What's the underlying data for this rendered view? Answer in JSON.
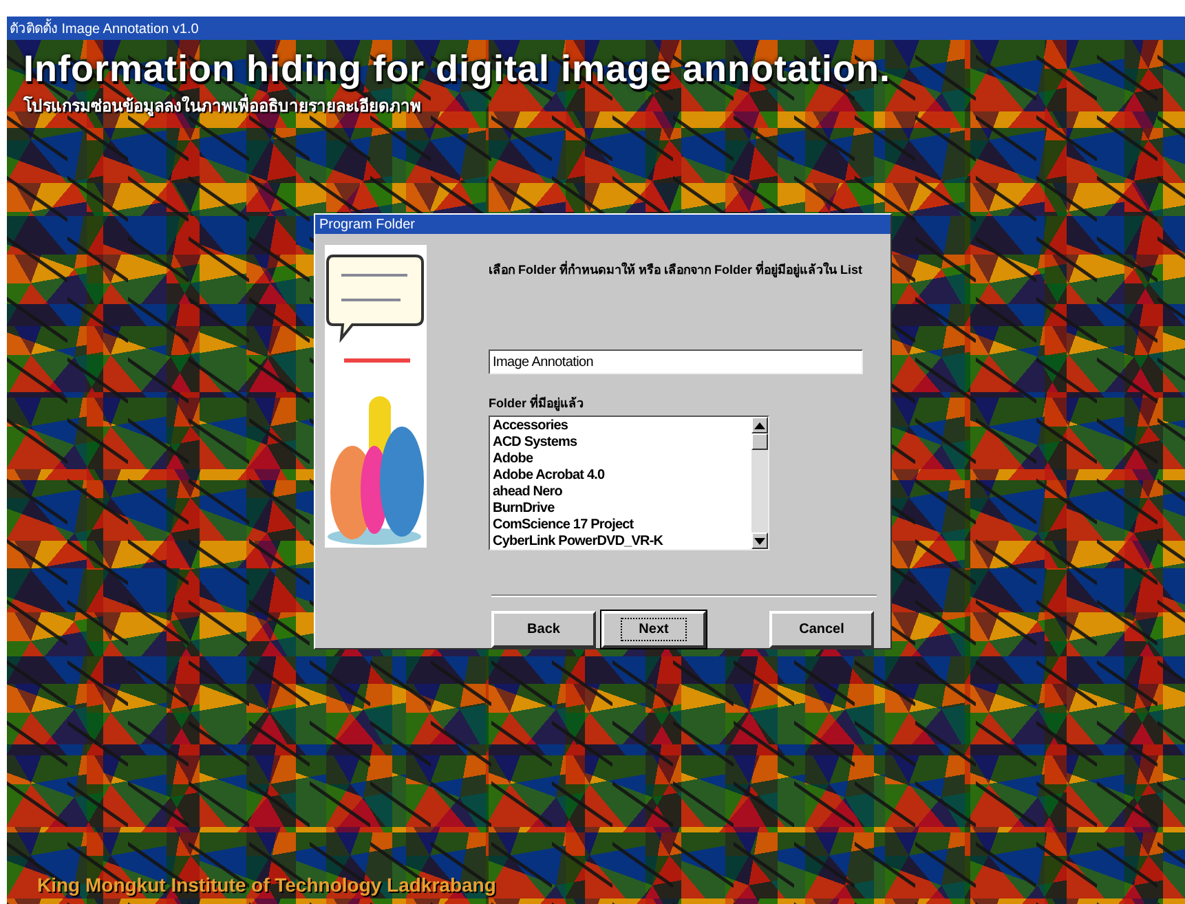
{
  "window": {
    "title": "ตัวติดตั้ง Image Annotation  v1.0"
  },
  "banner": {
    "heading": "Information hiding for digital image annotation.",
    "subheading": "โปรแกรมซ่อนข้อมูลลงในภาพเพื่ออธิบายรายละเอียดภาพ"
  },
  "dialog": {
    "title": "Program Folder",
    "instruction": "เลือก Folder ที่กำหนดมาให้ หรือ เลือกจาก Folder ที่อยู่มีอยู่แล้วใน List",
    "folder_field": {
      "value": "Image Annotation"
    },
    "list_label": "Folder ที่มีอยู่แล้ว",
    "folders": [
      {
        "label": "Accessories",
        "selected": false
      },
      {
        "label": "ACD Systems",
        "selected": false
      },
      {
        "label": "Adobe",
        "selected": false
      },
      {
        "label": "Adobe Acrobat 4.0",
        "selected": false
      },
      {
        "label": "ahead Nero",
        "selected": false
      },
      {
        "label": "BurnDrive",
        "selected": false
      },
      {
        "label": "ComScience 17 Project",
        "selected": false
      },
      {
        "label": "CyberLink PowerDVD_VR-K",
        "selected": false
      }
    ],
    "buttons": [
      {
        "label": "Back",
        "default": false
      },
      {
        "label": "Next",
        "default": true
      },
      {
        "label": "Cancel",
        "default": false
      }
    ]
  },
  "footer": {
    "text": "King Mongkut Institute of Technology Ladkrabang"
  }
}
